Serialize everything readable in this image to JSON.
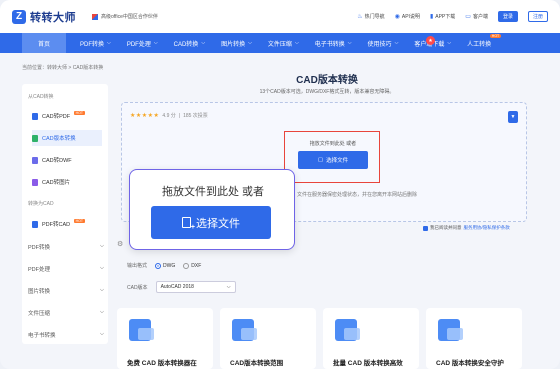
{
  "header": {
    "logo_char": "Z",
    "logo_text": "转转大师",
    "partner": "高级office中国区合作伙伴",
    "links": [
      {
        "label": "热门导航",
        "icon": "fire-icon"
      },
      {
        "label": "API说明",
        "icon": "api-icon"
      },
      {
        "label": "APP下载",
        "icon": "phone-icon"
      },
      {
        "label": "客户端",
        "icon": "monitor-icon"
      }
    ],
    "login": "登录",
    "register": "注册"
  },
  "nav": {
    "items": [
      {
        "label": "首页",
        "chev": false
      },
      {
        "label": "PDF转换",
        "chev": true
      },
      {
        "label": "PDF处理",
        "chev": true
      },
      {
        "label": "CAD转换",
        "chev": true
      },
      {
        "label": "图片转换",
        "chev": true
      },
      {
        "label": "文件压缩",
        "chev": true
      },
      {
        "label": "电子书转换",
        "chev": true
      },
      {
        "label": "使用技巧",
        "chev": true
      },
      {
        "label": "客户端下载",
        "chev": true
      },
      {
        "label": "人工转换",
        "chev": false
      }
    ],
    "hot_badge": "HOT",
    "bell": "★"
  },
  "breadcrumb": "当前位置：转转大师 > CAD版本转换",
  "sidebar": {
    "section_from": "从CAD转换",
    "items": [
      {
        "label": "CAD转PDF",
        "color": "#2f6ae8",
        "tag": "HOT"
      },
      {
        "label": "CAD版本转换",
        "color": "#2fb26a",
        "tag": ""
      },
      {
        "label": "CAD转DWF",
        "color": "#6b6bea",
        "tag": ""
      },
      {
        "label": "CAD转图片",
        "color": "#8a5be8",
        "tag": ""
      }
    ],
    "section_to": "转换为CAD",
    "pdf_to_cad": {
      "label": "PDF转CAD",
      "color": "#2f6ae8",
      "tag": "HOT"
    },
    "groups": [
      "PDF转换",
      "PDF处理",
      "图片转换",
      "文件压缩",
      "电子书转换"
    ]
  },
  "main": {
    "title": "CAD版本转换",
    "subtitle": "13个CAD版本可选，DWG/DXF格式互转，版本兼容无障碍。",
    "rating": {
      "stars": "★★★★★",
      "score": "4.9 分",
      "votes": "185 次投票"
    },
    "drop_text": "拖放文件到此处 或者",
    "choose_label": "选择文件",
    "notice": "文件在服务器保密处理状态，并在您离开本网站后删除",
    "agree_prefix": "我已阅读并同意",
    "agree_link": "服务用协/隐私保护条款",
    "output_format_label": "输出格式",
    "formats": [
      "DWG",
      "DXF"
    ],
    "selected_format": "DWG",
    "cad_version_label": "CAD版本",
    "cad_version_value": "AutoCAD 2018"
  },
  "cards": [
    {
      "title": "免费 CAD 版本转换器在"
    },
    {
      "title": "CAD版本转换范围"
    },
    {
      "title": "批量 CAD 版本转换高效"
    },
    {
      "title": "CAD 版本转换安全守护"
    }
  ],
  "popup": {
    "text": "拖放文件到此处 或者",
    "button": "选择文件"
  }
}
